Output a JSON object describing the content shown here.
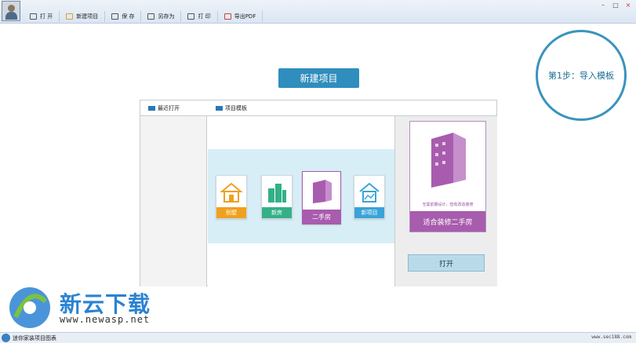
{
  "toolbar": {
    "items": [
      {
        "label": "打 开",
        "icon": "folder-open-icon"
      },
      {
        "label": "新建项目",
        "icon": "new-file-icon"
      },
      {
        "label": "保 存",
        "icon": "save-icon"
      },
      {
        "label": "另存为",
        "icon": "save-as-icon"
      },
      {
        "label": "打 印",
        "icon": "print-icon"
      },
      {
        "label": "导出PDF",
        "icon": "pdf-icon"
      }
    ]
  },
  "step": {
    "text": "第1步：导入模板"
  },
  "header": {
    "title": "新建项目"
  },
  "panel": {
    "tab_recent": "最近打开",
    "tab_templates": "项目模板",
    "templates": [
      {
        "label": "别墅",
        "color": "#f0a01e",
        "icon": "villa-icon"
      },
      {
        "label": "新房",
        "color": "#33b088",
        "icon": "new-house-icon"
      },
      {
        "label": "二手房",
        "color": "#a85cae",
        "icon": "second-hand-house-icon",
        "selected": true
      },
      {
        "label": "新项目",
        "color": "#3aa3d8",
        "icon": "new-project-icon"
      }
    ],
    "detail": {
      "desc": "无需前期设计，但有改造装修",
      "name": "适合装修二手房"
    },
    "open_label": "打开"
  },
  "watermark": {
    "title": "新云下载",
    "url": "www.newasp.net"
  },
  "statusbar": {
    "text": "迷你家装项目图表",
    "url": "www.sec188.com"
  },
  "colors": {
    "accent": "#2f8ebd",
    "purple": "#a85cae",
    "band": "#d8eef7"
  }
}
